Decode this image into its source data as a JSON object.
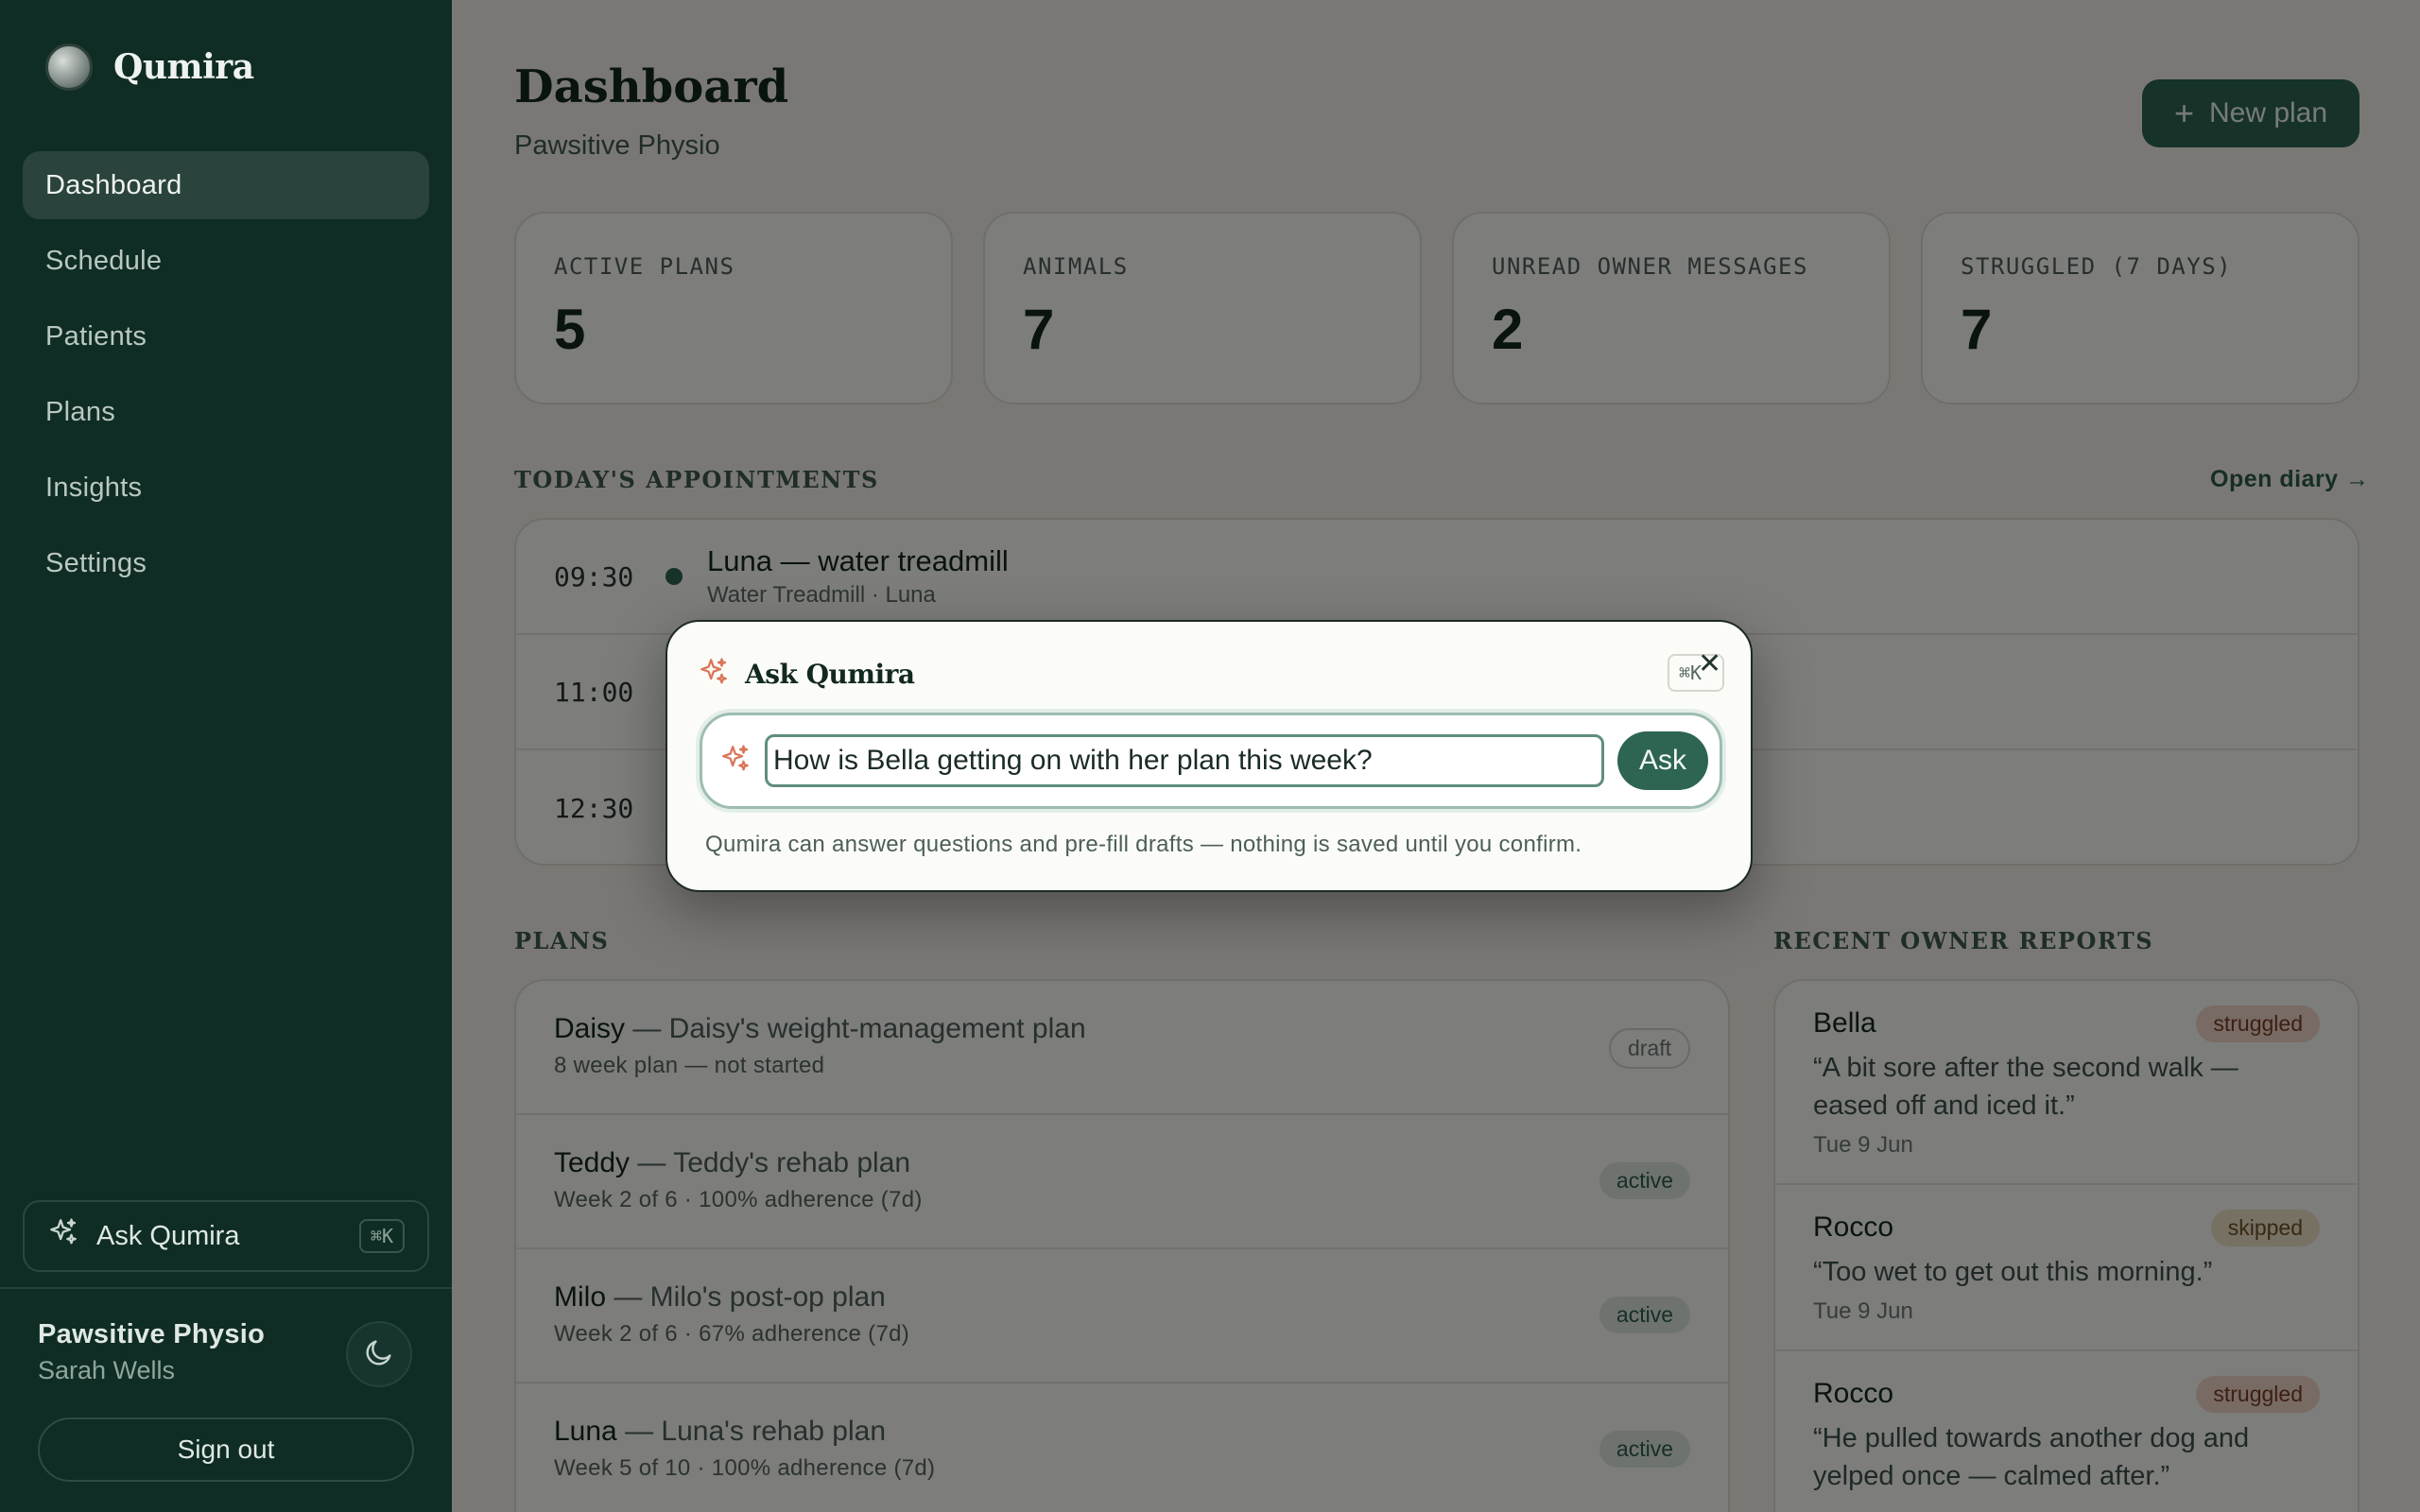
{
  "app": {
    "name": "Qumira"
  },
  "sidebar": {
    "items": [
      {
        "label": "Dashboard",
        "active": true
      },
      {
        "label": "Schedule"
      },
      {
        "label": "Patients"
      },
      {
        "label": "Plans"
      },
      {
        "label": "Insights"
      },
      {
        "label": "Settings"
      }
    ],
    "ask": {
      "label": "Ask Qumira",
      "shortcut": "⌘K"
    },
    "account": {
      "org": "Pawsitive Physio",
      "user": "Sarah Wells"
    },
    "sign_out": "Sign out"
  },
  "header": {
    "title": "Dashboard",
    "subtitle": "Pawsitive Physio",
    "new_plan": "New plan"
  },
  "stats": [
    {
      "label": "ACTIVE PLANS",
      "value": "5"
    },
    {
      "label": "ANIMALS",
      "value": "7"
    },
    {
      "label": "UNREAD OWNER MESSAGES",
      "value": "2"
    },
    {
      "label": "STRUGGLED (7 DAYS)",
      "value": "7"
    }
  ],
  "appointments": {
    "heading": "TODAY'S APPOINTMENTS",
    "open_diary": "Open diary →",
    "items": [
      {
        "time": "09:30",
        "title": "Luna — water treadmill",
        "sub": "Water Treadmill · Luna"
      },
      {
        "time": "11:00",
        "title": "",
        "sub": ""
      },
      {
        "time": "12:30",
        "title": "",
        "sub": ""
      }
    ]
  },
  "plans": {
    "heading": "PLANS",
    "items": [
      {
        "animal": "Daisy",
        "name": " — Daisy's weight-management plan",
        "sub": "8 week plan — not started",
        "status": "draft"
      },
      {
        "animal": "Teddy",
        "name": " — Teddy's rehab plan",
        "sub": "Week 2 of 6 · 100% adherence (7d)",
        "status": "active"
      },
      {
        "animal": "Milo",
        "name": " — Milo's post-op plan",
        "sub": "Week 2 of 6 · 67% adherence (7d)",
        "status": "active"
      },
      {
        "animal": "Luna",
        "name": " — Luna's rehab plan",
        "sub": "Week 5 of 10 · 100% adherence (7d)",
        "status": "active"
      }
    ]
  },
  "reports": {
    "heading": "RECENT OWNER REPORTS",
    "items": [
      {
        "name": "Bella",
        "status": "struggled",
        "quote": "“A bit sore after the second walk — eased off and iced it.”",
        "date": "Tue 9 Jun"
      },
      {
        "name": "Rocco",
        "status": "skipped",
        "quote": "“Too wet to get out this morning.”",
        "date": "Tue 9 Jun"
      },
      {
        "name": "Rocco",
        "status": "struggled",
        "quote": "“He pulled towards another dog and yelped once — calmed after.”",
        "date": ""
      }
    ]
  },
  "modal": {
    "title": "Ask Qumira",
    "shortcut": "⌘K",
    "input_value": "How is Bella getting on with her plan this week?",
    "submit": "Ask",
    "note": "Qumira can answer questions and pre-fill drafts — nothing is saved until you confirm."
  },
  "colors": {
    "sidebar_bg": "#0f2c25",
    "accent": "#2d6552",
    "sparkle": "#d9765a",
    "struggled_badge": "#f1d6c9",
    "skipped_badge": "#efe2c9"
  },
  "icons": [
    "sparkles-icon",
    "plus-icon",
    "moon-icon",
    "close-icon"
  ]
}
